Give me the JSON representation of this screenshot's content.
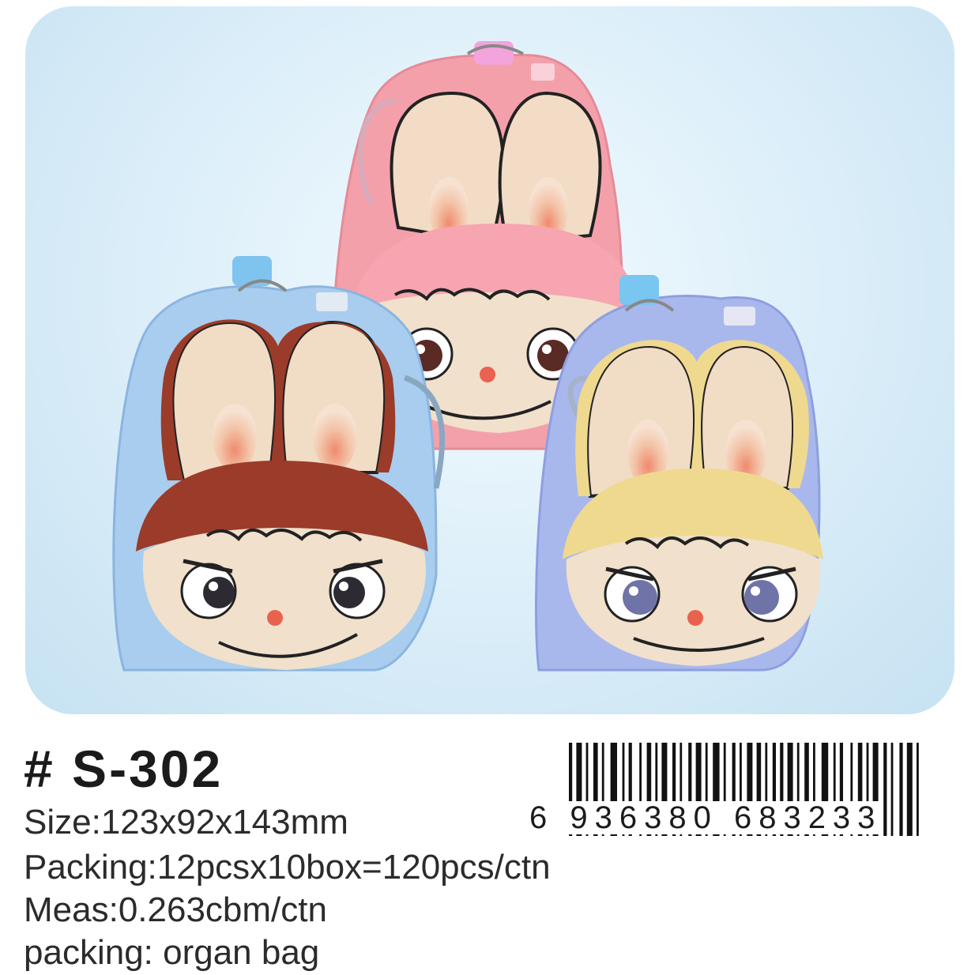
{
  "product": {
    "model": "# S-302",
    "specs": {
      "size": "Size:123x92x143mm",
      "packing": "Packing:12pcsx10box=120pcs/ctn",
      "meas": "Meas:0.263cbm/ctn",
      "bag": "packing: organ bag"
    },
    "barcode_number": "6 936380 683233"
  },
  "photo": {
    "items": [
      {
        "name": "pink-tin-bank",
        "color": "#f4a3ad"
      },
      {
        "name": "blue-tin-bank-brown-hair",
        "color": "#a9cdee"
      },
      {
        "name": "purple-tin-bank-yellow-hair",
        "color": "#a9b8ec"
      }
    ]
  },
  "colors": {
    "background": "#ffffff",
    "panel": "#d9edf8",
    "text": "#1b1b1b"
  }
}
